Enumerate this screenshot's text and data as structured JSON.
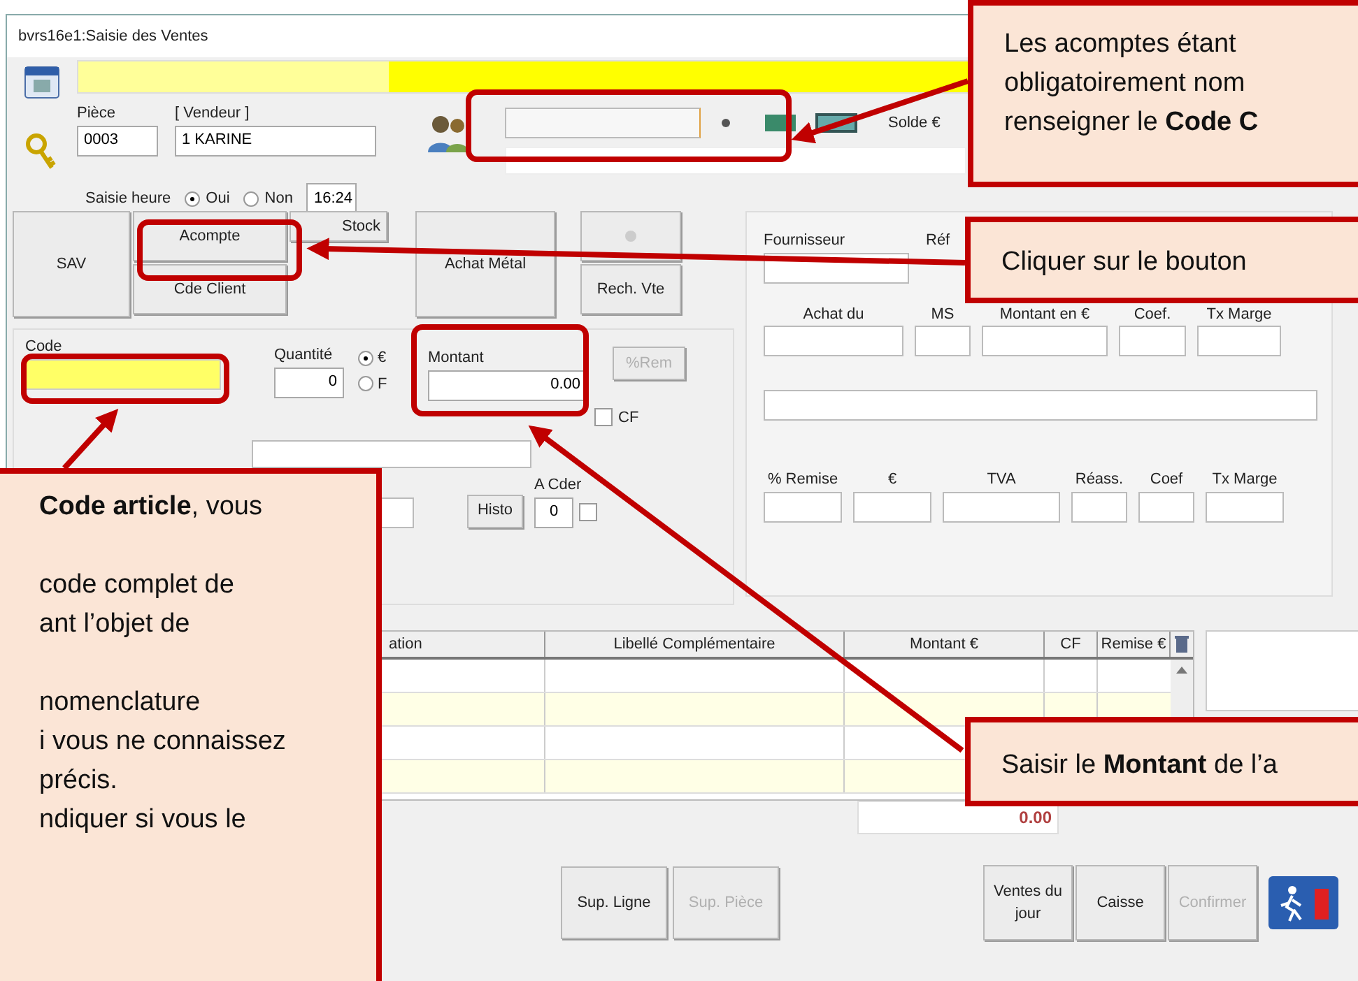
{
  "window": {
    "title": "bvrs16e1:Saisie des Ventes"
  },
  "header": {
    "piece_label": "Pièce",
    "piece_value": "0003",
    "vendeur_label": "[ Vendeur ]",
    "vendeur_value": "1   KARINE",
    "saisie_heure_label": "Saisie heure",
    "radios": [
      {
        "label": "Oui",
        "selected": true
      },
      {
        "label": "Non",
        "selected": false
      }
    ],
    "heure": "16:24",
    "solde_label": "Solde €"
  },
  "buttons": {
    "sav": "SAV",
    "acompte": "Acompte",
    "cde_client": "Cde Client",
    "stock": "Stock",
    "achat_metal": "Achat Métal",
    "rech_vte": "Rech. Vte"
  },
  "article": {
    "code_label": "Code",
    "quantite_label": "Quantité",
    "quantite_value": "0",
    "unit_options": [
      {
        "label": "€",
        "selected": true
      },
      {
        "label": "F",
        "selected": false
      }
    ],
    "montant_label": "Montant",
    "montant_value": "0.00",
    "rem_button": "%Rem",
    "cf_label": "CF",
    "cf_checked": false,
    "a_cder_label": "A Cder",
    "a_cder_value": "0",
    "a_cder_checked": false,
    "histo_button": "Histo"
  },
  "purchase_panel": {
    "fournisseur_label": "Fournisseur",
    "ref_label": "Réf",
    "row1_labels": [
      "Achat du",
      "MS",
      "Montant en €",
      "Coef.",
      "Tx Marge"
    ],
    "row2_labels": [
      "% Remise",
      "€",
      "TVA",
      "Réass.",
      "Coef",
      "Tx Marge"
    ]
  },
  "grid": {
    "columns": [
      "ation",
      "Libellé Complémentaire",
      "Montant €",
      "CF",
      "Remise €"
    ],
    "total": "0.00"
  },
  "edit_buttons": [
    {
      "label": "Sup. Ligne",
      "disabled": false
    },
    {
      "label": "Sup. Pièce",
      "disabled": true
    }
  ],
  "main_buttons": [
    {
      "label": "Ventes du jour",
      "disabled": false
    },
    {
      "label": "Caisse",
      "disabled": false
    },
    {
      "label": "Confirmer",
      "disabled": true
    }
  ],
  "callouts": [
    {
      "paragraphs": [
        [
          "Les acomptes étant",
          "obligatoirement nom",
          "renseigner  le **Code C**"
        ]
      ]
    },
    {
      "paragraphs": [
        [
          "Cliquer sur le bouton"
        ]
      ]
    },
    {
      "paragraphs": [
        [
          "**Code article**, vous"
        ],
        [
          "code complet de",
          "ant l’objet de"
        ],
        [
          "nomenclature",
          "i vous ne connaissez",
          "précis.",
          "ndiquer si vous le"
        ]
      ]
    },
    {
      "paragraphs": [
        [
          "Saisir le **Montant** de l’a"
        ]
      ]
    }
  ]
}
